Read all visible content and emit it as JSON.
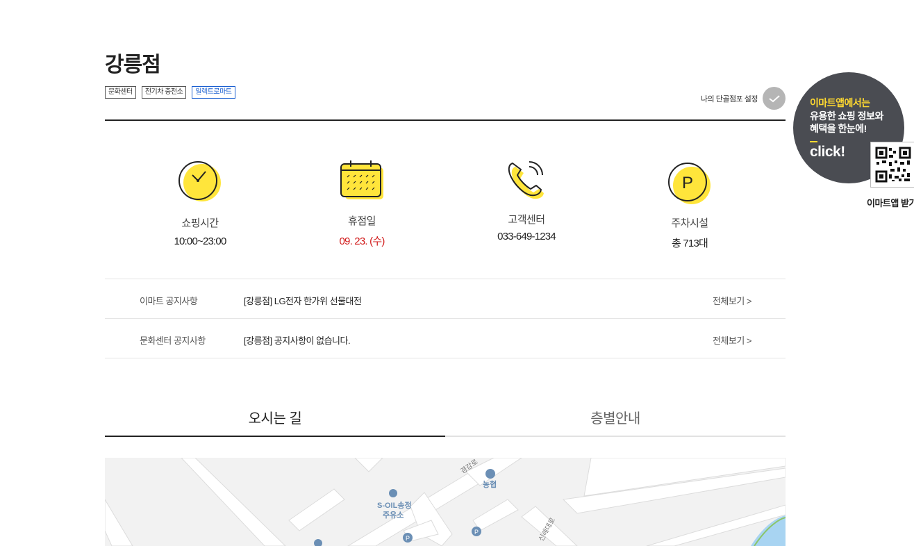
{
  "store": {
    "title": "강릉점",
    "tags": [
      "문화센터",
      "전기차 충전소",
      "일렉트로마트"
    ],
    "favorite_label": "나의 단골점포 설정"
  },
  "info": [
    {
      "icon": "clock-icon",
      "label": "쇼핑시간",
      "value": "10:00~23:00"
    },
    {
      "icon": "calendar-icon",
      "label": "휴점일",
      "value": "09. 23. (수)"
    },
    {
      "icon": "phone-icon",
      "label": "고객센터",
      "value": "033-649-1234"
    },
    {
      "icon": "parking-icon",
      "label": "주차시설",
      "value": "총 713대"
    }
  ],
  "notices": [
    {
      "category": "이마트 공지사항",
      "text": "[강릉점] LG전자 한가위 선물대전",
      "more": "전체보기 >"
    },
    {
      "category": "문화센터 공지사항",
      "text": "[강릉점] 공지사항이 없습니다.",
      "more": "전체보기 >"
    }
  ],
  "tabs": [
    {
      "label": "오시는 길",
      "active": true
    },
    {
      "label": "층별안내",
      "active": false
    }
  ],
  "map": {
    "labels": [
      "경강로",
      "농협",
      "S-OIL송정",
      "주유소",
      "신례대로"
    ]
  },
  "promo": {
    "line1": "이마트앱에서는",
    "line2": "유용한 쇼핑 정보와",
    "line3": "혜택을 한눈에!",
    "click": "click!",
    "caption": "이마트앱 받기"
  },
  "colors": {
    "accent_yellow": "#ffe53b",
    "holiday_red": "#d11919",
    "promo_bg": "#4a4c52",
    "promo_yellow": "#ffd930"
  }
}
